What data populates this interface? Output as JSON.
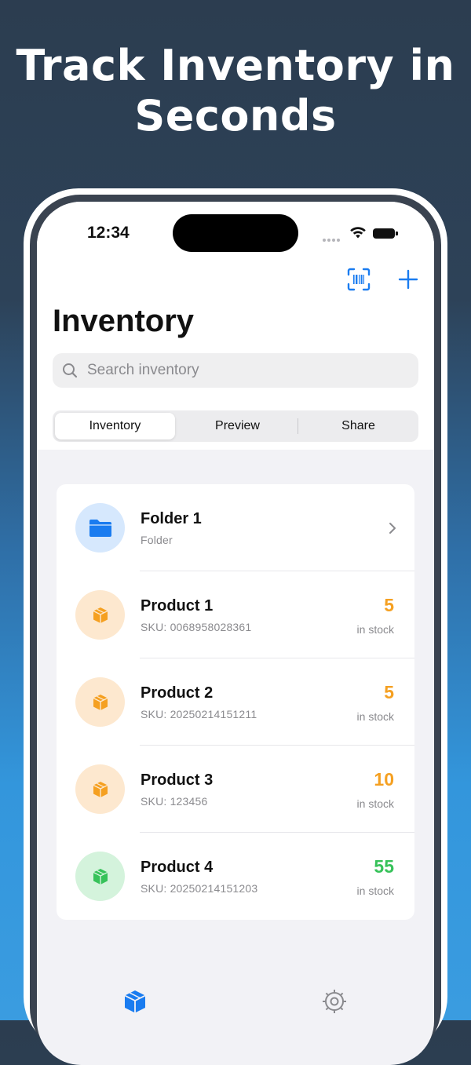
{
  "headline": {
    "line1": "Track Inventory in",
    "line2": "Seconds"
  },
  "status_bar": {
    "time": "12:34"
  },
  "nav": {
    "scan_icon": "barcode-scan-icon",
    "add_icon": "plus-icon"
  },
  "page_title": "Inventory",
  "search": {
    "placeholder": "Search inventory"
  },
  "segments": [
    {
      "label": "Inventory",
      "active": true
    },
    {
      "label": "Preview",
      "active": false
    },
    {
      "label": "Share",
      "active": false
    }
  ],
  "items": [
    {
      "type": "folder",
      "name": "Folder 1",
      "subtitle": "Folder",
      "icon": "folder-icon",
      "color": "#1a7cf0",
      "bg": "#d6e8fd"
    },
    {
      "type": "product",
      "name": "Product 1",
      "subtitle": "SKU: 0068958028361",
      "quantity": "5",
      "quantity_label": "in stock",
      "color": "#f5a021",
      "bg": "#fde8cf",
      "qty_color": "#f5a021"
    },
    {
      "type": "product",
      "name": "Product 2",
      "subtitle": "SKU: 20250214151211",
      "quantity": "5",
      "quantity_label": "in stock",
      "color": "#f5a021",
      "bg": "#fde8cf",
      "qty_color": "#f5a021"
    },
    {
      "type": "product",
      "name": "Product 3",
      "subtitle": "SKU: 123456",
      "quantity": "10",
      "quantity_label": "in stock",
      "color": "#f5a021",
      "bg": "#fde8cf",
      "qty_color": "#f5a021"
    },
    {
      "type": "product",
      "name": "Product 4",
      "subtitle": "SKU: 20250214151203",
      "quantity": "55",
      "quantity_label": "in stock",
      "color": "#37c25a",
      "bg": "#d4f3dc",
      "qty_color": "#37c25a"
    }
  ],
  "tab_bar": {
    "inventory_icon": "box-icon",
    "settings_icon": "gear-icon",
    "active_color": "#1a7cf0",
    "inactive_color": "#8a8a8e"
  }
}
